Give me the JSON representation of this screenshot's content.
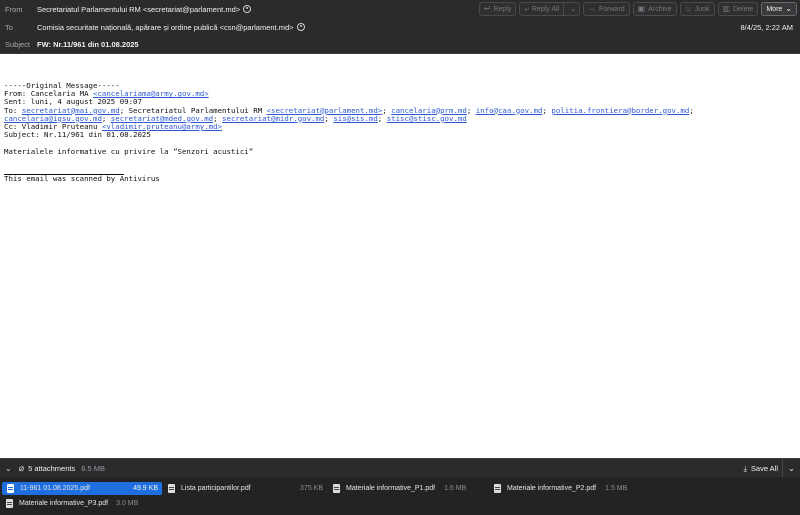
{
  "header": {
    "from_label": "From",
    "from_value": "Secretariatul Parlamentului RM <secretariat@parlament.md>",
    "to_label": "To",
    "to_value": "Comisia securitate națională, apărare și ordine publică <csn@parlament.md>",
    "date": "8/4/25, 2:22 AM",
    "subject_label": "Subject",
    "subject_value": "FW: Nr.11/961 din 01.08.2025"
  },
  "toolbar": {
    "reply": "Reply",
    "reply_all": "Reply All",
    "forward": "Forward",
    "archive": "Archive",
    "junk": "Junk",
    "delete": "Delete",
    "more": "More"
  },
  "message": {
    "separator": "-----Original Message-----",
    "from_prefix": "From: Cancelaria MA ",
    "from_email": "<cancelariama@army.gov.md>",
    "sent": "Sent: luni, 4 august 2025 09:07",
    "to_prefix": "To: ",
    "to_1": "secretariat@mai.gov.md",
    "to_mid": "; Secretariatul Parlamentului RM ",
    "to_2": "<secretariat@parlament.md>",
    "to_3": "cancelaria@prm.md",
    "to_4": "info@caa.gov.md",
    "to_5": "politia.frontiera@border.gov.md",
    "to_6": "cancelaria@igsu.gov.md",
    "to_7": "secretariat@mded.gov.md",
    "to_8": "secretariat@midr.gov.md",
    "to_9": "sis@sis.md",
    "to_10": "stisc@stisc.gov.md",
    "cc_prefix": "Cc: Vladimir Pruteanu ",
    "cc_email": "<vladimir.pruteanu@army.md>",
    "subject": "Subject: Nr.11/961 din 01.08.2025",
    "body": "Materialele informative cu privire la ”Senzori acustici”",
    "scanned": "This email was scanned by Antivirus"
  },
  "attachments": {
    "count_label": "5 attachments",
    "total_size": "6.5 MB",
    "save_all": "Save All",
    "items": [
      {
        "name": "11-961 01.08.2025.pdf",
        "size": "49.9 KB"
      },
      {
        "name": "Lista participantilor.pdf",
        "size": "375 KB"
      },
      {
        "name": "Materiale informative_P1.pdf",
        "size": "1.6 MB"
      },
      {
        "name": "Materiale informative_P2.pdf",
        "size": "1.5 MB"
      },
      {
        "name": "Materiale informative_P3.pdf",
        "size": "3.0 MB"
      }
    ]
  }
}
